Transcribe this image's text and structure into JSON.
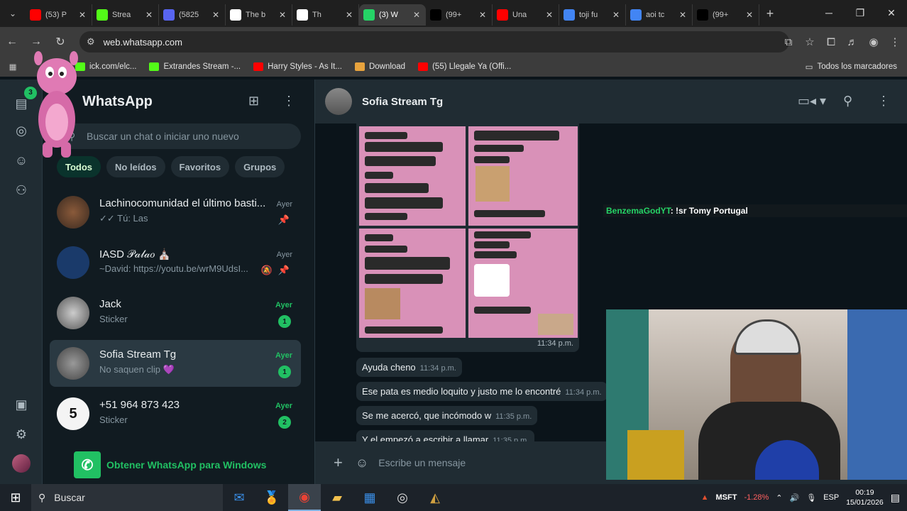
{
  "browser": {
    "tabs": [
      {
        "title": "(53) P",
        "icon": "youtube-icon",
        "color": "#ff0000"
      },
      {
        "title": "Strea",
        "icon": "kick-icon",
        "color": "#53fc18"
      },
      {
        "title": "(5825",
        "icon": "discord-icon",
        "color": "#5865f2"
      },
      {
        "title": "The b",
        "icon": "diamond-icon",
        "color": "#ffffff"
      },
      {
        "title": "Th",
        "icon": "diamond-icon",
        "color": "#ffffff"
      },
      {
        "title": "(3) W",
        "icon": "whatsapp-icon",
        "color": "#25d366",
        "active": true
      },
      {
        "title": "(99+",
        "icon": "tiktok-icon",
        "color": "#000000"
      },
      {
        "title": "Una",
        "icon": "youtube-icon",
        "color": "#ff0000"
      },
      {
        "title": "toji fu",
        "icon": "chrome-icon",
        "color": "#4285f4"
      },
      {
        "title": "aoi tc",
        "icon": "google-icon",
        "color": "#4285f4"
      },
      {
        "title": "(99+",
        "icon": "tiktok-icon",
        "color": "#000000"
      }
    ],
    "url": "web.whatsapp.com",
    "bookmarks": [
      {
        "label": "ick.com/elc...",
        "color": "#53fc18"
      },
      {
        "label": "Extrandes Stream -...",
        "color": "#53fc18"
      },
      {
        "label": "Harry Styles - As It...",
        "color": "#ff0000"
      },
      {
        "label": "Download",
        "color": "#e8a33d"
      },
      {
        "label": "(55) Llegale Ya (Offi...",
        "color": "#ff0000"
      }
    ],
    "all_bookmarks": "Todos los marcadores"
  },
  "whatsapp": {
    "title": "WhatsApp",
    "status_count": "3",
    "search_placeholder": "Buscar un chat o iniciar uno nuevo",
    "filters": [
      "Todos",
      "No leídos",
      "Favoritos",
      "Grupos"
    ],
    "chats": [
      {
        "name": "Lachinocomunidad el último basti...",
        "preview": "✓✓ Tú: Las",
        "time": "Ayer",
        "pinned": true
      },
      {
        "name": "IASD 𝒫𝒶𝓁𝒶𝑜 ⛪",
        "preview": "~David: https://youtu.be/wrM9UdsI...",
        "time": "Ayer",
        "muted": true,
        "pinned": true
      },
      {
        "name": "Jack",
        "preview": "Sticker",
        "time": "Ayer",
        "unread": "1"
      },
      {
        "name": "Sofia Stream Tg",
        "preview": "No saquen clip 💜",
        "time": "Ayer",
        "unread": "1",
        "selected": true
      },
      {
        "name": "+51 964 873 423",
        "preview": "Sticker",
        "time": "Ayer",
        "unread": "2"
      }
    ],
    "get_app": "Obtener WhatsApp para Windows",
    "conversation": {
      "name": "Sofia Stream Tg",
      "image_time": "11:34 p.m.",
      "messages": [
        {
          "text": "Ayuda cheno",
          "time": "11:34 p.m."
        },
        {
          "text": "Ese pata es medio loquito y justo me lo encontré",
          "time": "11:34 p.m."
        },
        {
          "text": "Se me acercó, que incómodo w",
          "time": "11:35 p.m."
        },
        {
          "text": "Y el empezó a escribir a llamar",
          "time": "11:35 p.m."
        }
      ],
      "composer_placeholder": "Escribe un mensaje"
    }
  },
  "stream_chat": {
    "user": "BenzemaGodYT",
    "message": ": !sr Tomy Portugal"
  },
  "taskbar": {
    "search": "Buscar",
    "stock": "MSFT",
    "stock_change": "-1.28%",
    "lang": "ESP",
    "time": "00:19",
    "date": "15/01/2026"
  }
}
